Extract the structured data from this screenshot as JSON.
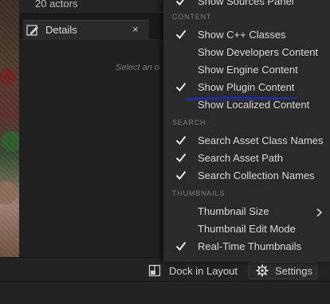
{
  "outliner": {
    "actors_count": "20 actors"
  },
  "details": {
    "tab_title": "Details",
    "close_glyph": "×",
    "empty_hint": "Select an o"
  },
  "bottom_bar": {
    "dock_label": "Dock in Layout",
    "settings_label": "Settings"
  },
  "menu": {
    "top_item": {
      "label": "Show Sources Panel",
      "checked": true
    },
    "sections": [
      {
        "header": "CONTENT",
        "items": [
          {
            "label": "Show C++ Classes",
            "checked": true
          },
          {
            "label": "Show Developers Content",
            "checked": false
          },
          {
            "label": "Show Engine Content",
            "checked": false
          },
          {
            "label": "Show Plugin Content",
            "checked": true
          },
          {
            "label": "Show Localized Content",
            "checked": false
          }
        ]
      },
      {
        "header": "SEARCH",
        "items": [
          {
            "label": "Search Asset Class Names",
            "checked": true
          },
          {
            "label": "Search Asset Path",
            "checked": true
          },
          {
            "label": "Search Collection Names",
            "checked": true
          }
        ]
      },
      {
        "header": "THUMBNAILS",
        "items": [
          {
            "label": "Thumbnail Size",
            "checked": false,
            "submenu": true
          },
          {
            "label": "Thumbnail Edit Mode",
            "checked": false
          },
          {
            "label": "Real-Time Thumbnails",
            "checked": true
          }
        ]
      }
    ]
  },
  "colors": {
    "annotation_underline": "#1e2fc8",
    "menu_bg": "#2a2a2a",
    "check": "#e6e6e6"
  },
  "icons": {
    "details": "pencil-panel-icon",
    "dock": "dock-layout-icon",
    "settings": "gear-icon",
    "check": "check-icon",
    "submenu": "chevron-right-icon"
  }
}
